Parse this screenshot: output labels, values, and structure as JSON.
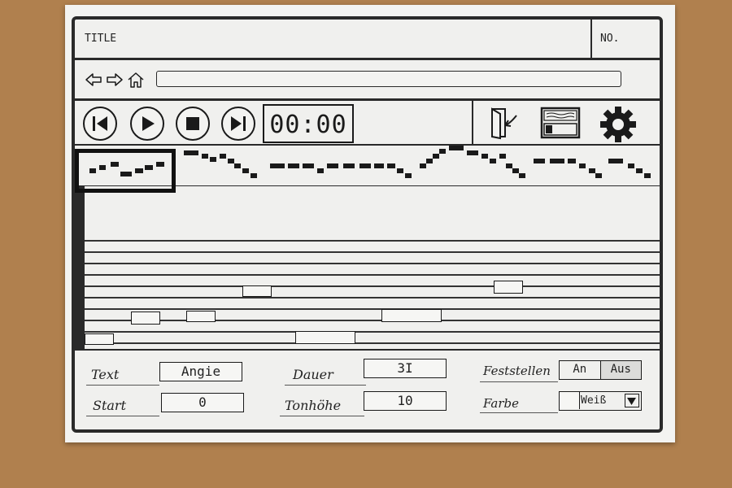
{
  "window": {
    "title": "TITLE",
    "number_label": "NO."
  },
  "navigation": {
    "icons": [
      "back-arrow-icon",
      "forward-arrow-icon",
      "home-icon"
    ],
    "address_value": ""
  },
  "toolbar": {
    "playback_icons": [
      "skip-back-icon",
      "play-icon",
      "stop-icon",
      "skip-forward-icon"
    ],
    "time_display": "00:00",
    "right_icons": [
      "door-exit-icon",
      "window-panel-icon",
      "gear-icon"
    ]
  },
  "melody_overview": {
    "selection": "start"
  },
  "staff": {
    "line_count": 10
  },
  "properties": {
    "text_label": "Text",
    "text_value": "Angie",
    "start_label": "Start",
    "start_value": "0",
    "duration_label": "Dauer",
    "duration_value": "3I",
    "pitch_label": "Tonhöhe",
    "pitch_value": "10",
    "lock_label": "Feststellen",
    "lock_on_label": "An",
    "lock_off_label": "Aus",
    "lock_selected": "Aus",
    "color_label": "Farbe",
    "color_value": "Weiß"
  },
  "colors": {
    "ink": "#1a1a1a",
    "paper": "#f3f3f1",
    "background": "#b0804e"
  }
}
